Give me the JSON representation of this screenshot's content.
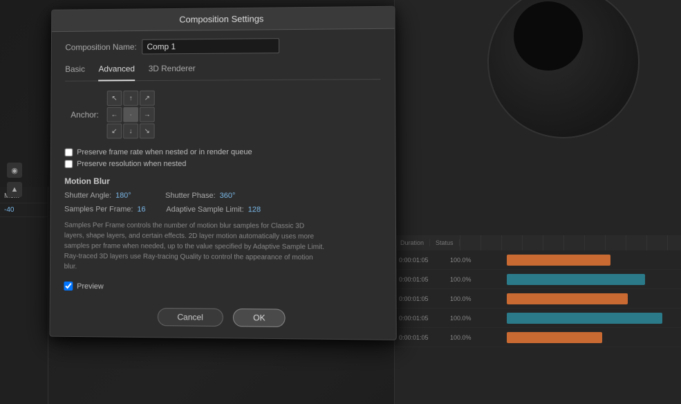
{
  "dialog": {
    "title": "Composition Settings",
    "comp_name_label": "Composition Name:",
    "comp_name_value": "Comp 1",
    "tabs": [
      {
        "label": "Basic",
        "active": false
      },
      {
        "label": "Advanced",
        "active": true
      },
      {
        "label": "3D Renderer",
        "active": false
      }
    ],
    "anchor_label": "Anchor:",
    "arrows": [
      {
        "dir": "nw",
        "symbol": "↖"
      },
      {
        "dir": "n",
        "symbol": "↑"
      },
      {
        "dir": "ne",
        "symbol": "↗"
      },
      {
        "dir": "w",
        "symbol": "←"
      },
      {
        "dir": "c",
        "symbol": "·"
      },
      {
        "dir": "e",
        "symbol": "→"
      },
      {
        "dir": "sw",
        "symbol": "↙"
      },
      {
        "dir": "s",
        "symbol": "↓"
      },
      {
        "dir": "se",
        "symbol": "↘"
      }
    ],
    "checkboxes": [
      {
        "label": "Preserve frame rate when nested or in render queue",
        "checked": false
      },
      {
        "label": "Preserve resolution when nested",
        "checked": false
      }
    ],
    "motion_blur_title": "Motion Blur",
    "shutter_angle_label": "Shutter Angle:",
    "shutter_angle_value": "180",
    "shutter_angle_unit": "°",
    "shutter_phase_label": "Shutter Phase:",
    "shutter_phase_value": "360",
    "shutter_phase_unit": "°",
    "samples_per_frame_label": "Samples Per Frame:",
    "samples_per_frame_value": "16",
    "adaptive_sample_label": "Adaptive Sample Limit:",
    "adaptive_sample_value": "128",
    "description": "Samples Per Frame controls the number of motion blur samples for Classic 3D layers, shape layers, and certain effects. 2D layer motion automatically uses more samples per frame when needed, up to the value specified by Adaptive Sample Limit. Ray-traced 3D layers use Ray-tracing Quality to control the appearance of motion blur.",
    "preview_label": "Preview",
    "preview_checked": true,
    "cancel_label": "Cancel",
    "ok_label": "OK"
  },
  "timeline": {
    "header": [
      {
        "label": "Duration"
      },
      {
        "label": "Status"
      }
    ],
    "rows": [
      {
        "duration": "0:00:01:05",
        "status": "100.0%",
        "bar_type": "orange",
        "bar_left": "0%",
        "bar_width": "60%"
      },
      {
        "duration": "0:00:01:05",
        "status": "100.0%",
        "bar_type": "teal",
        "bar_left": "0%",
        "bar_width": "80%"
      },
      {
        "duration": "0:00:01:05",
        "status": "100.0%",
        "bar_type": "orange",
        "bar_left": "0%",
        "bar_width": "70%"
      },
      {
        "duration": "0:00:01:05",
        "status": "100.0%",
        "bar_type": "teal",
        "bar_left": "0%",
        "bar_width": "90%"
      },
      {
        "duration": "0:00:01:05",
        "status": "100.0%",
        "bar_type": "orange",
        "bar_left": "0%",
        "bar_width": "55%"
      }
    ]
  },
  "left_panel": {
    "items": [
      {
        "label": "Mo..."
      },
      {
        "label": "-40"
      }
    ]
  },
  "colors": {
    "accent_blue": "#7ab8e8",
    "orange": "#c96a32",
    "teal": "#2a7a8a",
    "dialog_bg": "#2d2d2d",
    "tab_active": "#dddddd"
  }
}
